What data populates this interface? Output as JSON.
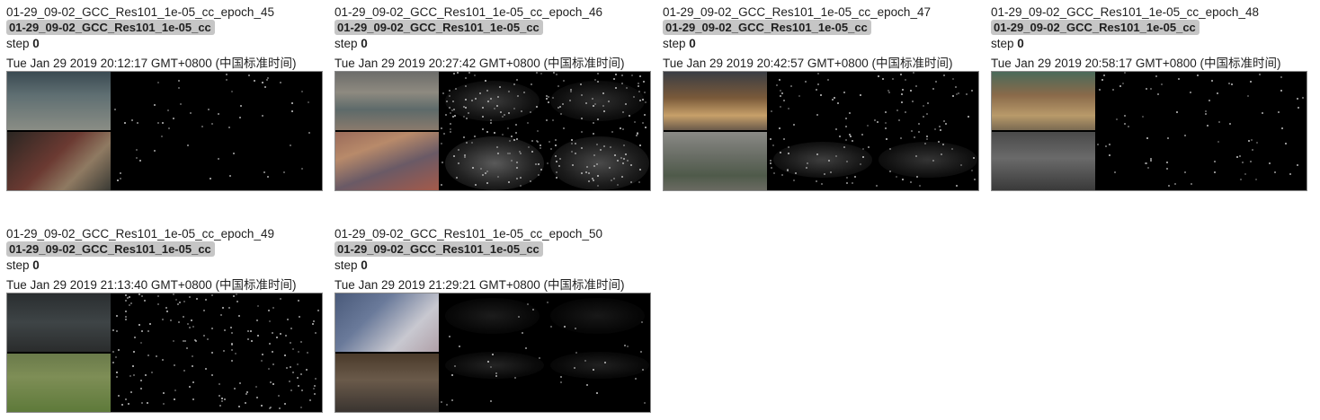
{
  "cards": [
    {
      "tag": "01-29_09-02_GCC_Res101_1e-05_cc_epoch_45",
      "run": "01-29_09-02_GCC_Res101_1e-05_cc",
      "step_label": "step",
      "step_value": "0",
      "walltime": "Tue Jan 29 2019 20:12:17 GMT+0800 (中国标准时间)"
    },
    {
      "tag": "01-29_09-02_GCC_Res101_1e-05_cc_epoch_46",
      "run": "01-29_09-02_GCC_Res101_1e-05_cc",
      "step_label": "step",
      "step_value": "0",
      "walltime": "Tue Jan 29 2019 20:27:42 GMT+0800 (中国标准时间)"
    },
    {
      "tag": "01-29_09-02_GCC_Res101_1e-05_cc_epoch_47",
      "run": "01-29_09-02_GCC_Res101_1e-05_cc",
      "step_label": "step",
      "step_value": "0",
      "walltime": "Tue Jan 29 2019 20:42:57 GMT+0800 (中国标准时间)"
    },
    {
      "tag": "01-29_09-02_GCC_Res101_1e-05_cc_epoch_48",
      "run": "01-29_09-02_GCC_Res101_1e-05_cc",
      "step_label": "step",
      "step_value": "0",
      "walltime": "Tue Jan 29 2019 20:58:17 GMT+0800 (中国标准时间)"
    },
    {
      "tag": "01-29_09-02_GCC_Res101_1e-05_cc_epoch_49",
      "run": "01-29_09-02_GCC_Res101_1e-05_cc",
      "step_label": "step",
      "step_value": "0",
      "walltime": "Tue Jan 29 2019 21:13:40 GMT+0800 (中国标准时间)"
    },
    {
      "tag": "01-29_09-02_GCC_Res101_1e-05_cc_epoch_50",
      "run": "01-29_09-02_GCC_Res101_1e-05_cc",
      "step_label": "step",
      "step_value": "0",
      "walltime": "Tue Jan 29 2019 21:29:21 GMT+0800 (中国标准时间)"
    }
  ],
  "colors": {
    "run_chip_bg": "#c6c6c6",
    "image_bg": "#000000",
    "text": "#212121"
  }
}
